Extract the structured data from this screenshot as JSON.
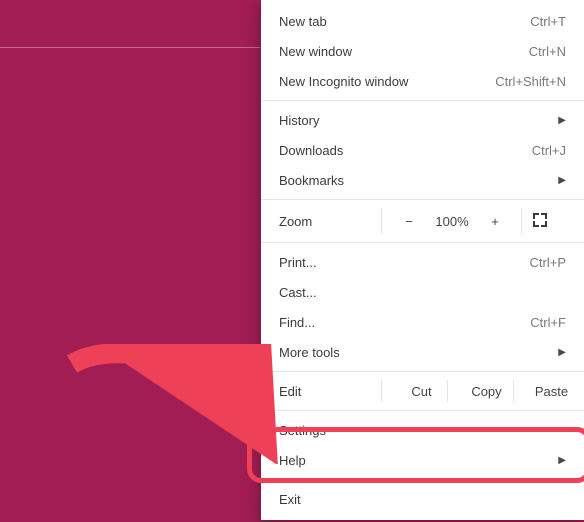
{
  "menu": {
    "new_tab": {
      "label": "New tab",
      "shortcut": "Ctrl+T"
    },
    "new_window": {
      "label": "New window",
      "shortcut": "Ctrl+N"
    },
    "incognito": {
      "label": "New Incognito window",
      "shortcut": "Ctrl+Shift+N"
    },
    "history": {
      "label": "History"
    },
    "downloads": {
      "label": "Downloads",
      "shortcut": "Ctrl+J"
    },
    "bookmarks": {
      "label": "Bookmarks"
    },
    "zoom": {
      "label": "Zoom",
      "minus": "−",
      "value": "100%",
      "plus": "+",
      "fullscreen": "Full screen"
    },
    "print": {
      "label": "Print...",
      "shortcut": "Ctrl+P"
    },
    "cast": {
      "label": "Cast..."
    },
    "find": {
      "label": "Find...",
      "shortcut": "Ctrl+F"
    },
    "more_tools": {
      "label": "More tools"
    },
    "edit": {
      "label": "Edit",
      "cut": "Cut",
      "copy": "Copy",
      "paste": "Paste"
    },
    "settings": {
      "label": "Settings"
    },
    "help": {
      "label": "Help"
    },
    "exit": {
      "label": "Exit"
    }
  },
  "annotation": {
    "color": "#ee4056",
    "target": "settings"
  }
}
